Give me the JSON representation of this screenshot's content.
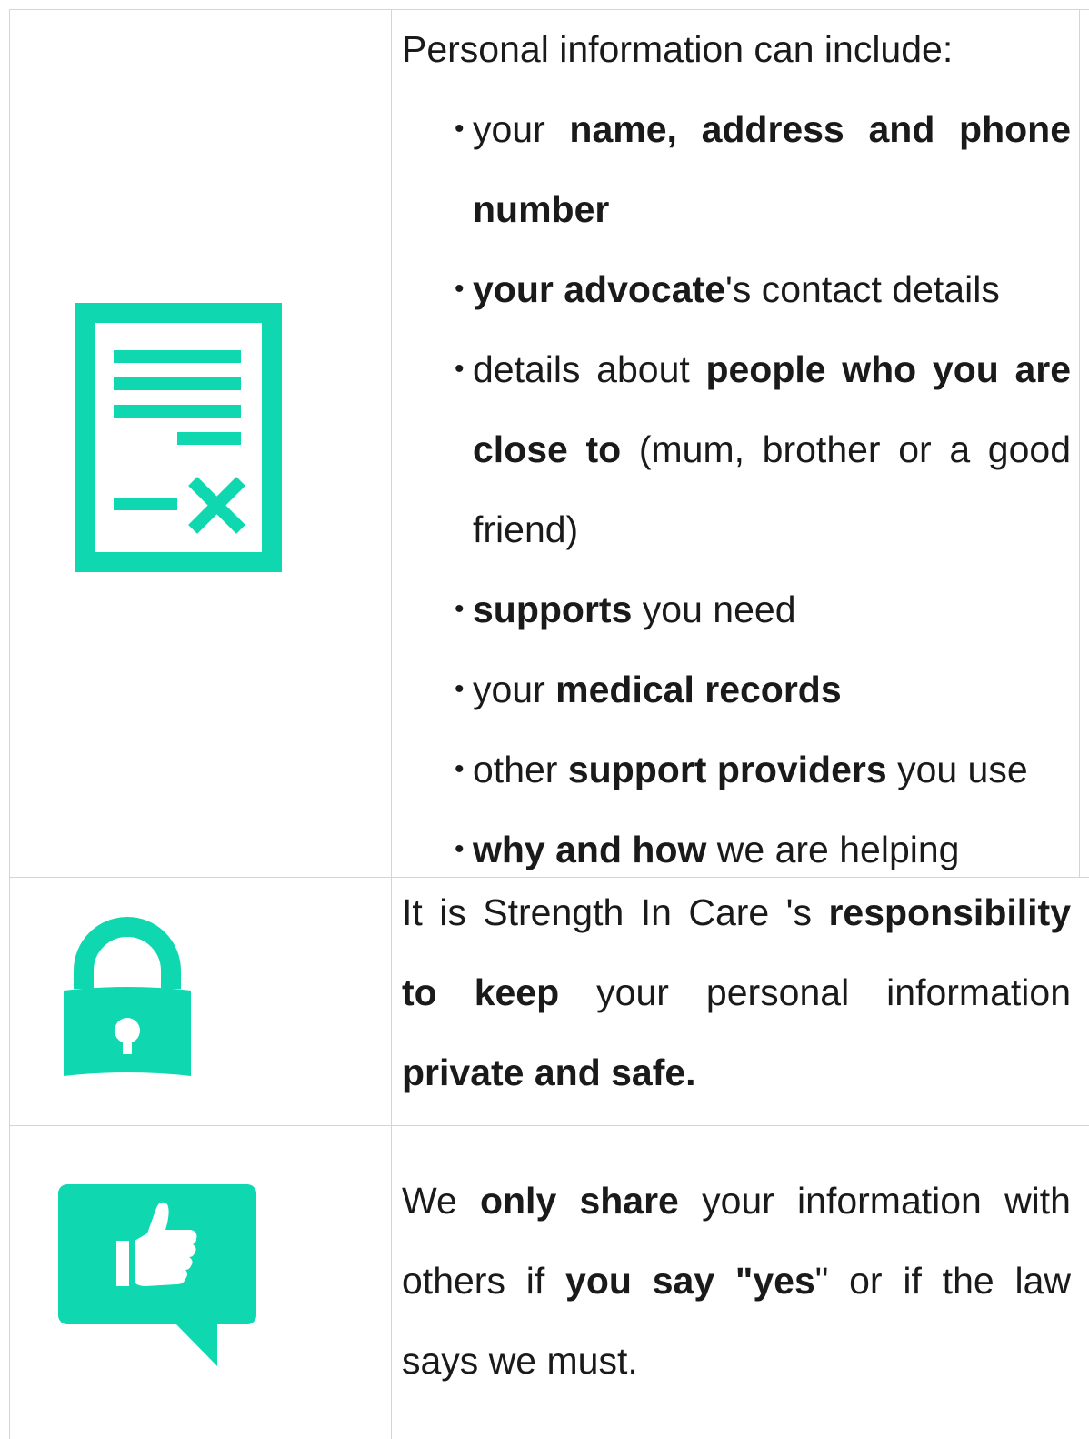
{
  "colors": {
    "accent": "#0fd8b0",
    "border": "#c9d7e8"
  },
  "section_info": {
    "icon": "document-with-x-icon",
    "intro": "Personal information can include:",
    "items": [
      {
        "pre": "your ",
        "bold": "name, address and phone number",
        "post": ""
      },
      {
        "pre": "",
        "bold": "your advocate",
        "post": "'s contact details"
      },
      {
        "pre": "details about ",
        "bold": "people who you are close to",
        "post": " (mum, brother or a good friend)"
      },
      {
        "pre": "",
        "bold": "supports",
        "post": " you need"
      },
      {
        "pre": "your ",
        "bold": "medical records",
        "post": ""
      },
      {
        "pre": "other ",
        "bold": "support providers",
        "post": " you use"
      },
      {
        "pre": "",
        "bold": "why and how",
        "post": " we are helping"
      }
    ]
  },
  "section_security": {
    "icon": "padlock-icon",
    "pre": "It is Strength In Care 's ",
    "bold1": "responsibility to keep",
    "mid": " your personal information ",
    "bold2": "private and safe."
  },
  "section_sharing": {
    "icon": "thumbs-up-speech-bubble-icon",
    "pre": "We ",
    "bold1": "only share",
    "mid": " your information with others if ",
    "bold2": "you say \"yes",
    "post": "\" or if the law says we must."
  }
}
